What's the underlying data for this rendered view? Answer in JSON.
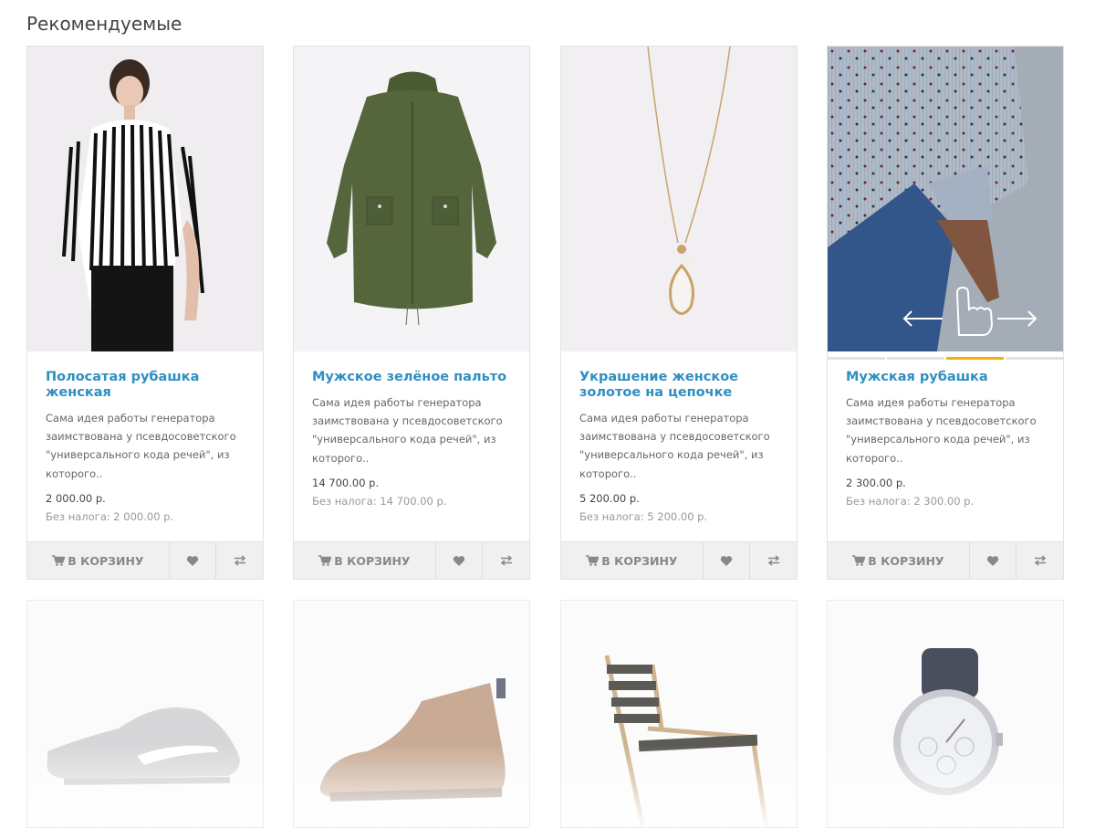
{
  "section": {
    "title": "Рекомендуемые"
  },
  "products": [
    {
      "name": "Полосатая рубашка женская",
      "description": "Сама идея работы генератора заимствована у псевдосоветского \"универсального кода речей\", из которого..",
      "price": "2 000.00 р.",
      "tax": "Без налога: 2 000.00 р.",
      "cart_label": "В КОРЗИНУ"
    },
    {
      "name": "Мужское зелёное пальто",
      "description": "Сама идея работы генератора заимствована у псевдосоветского \"универсального кода речей\", из которого..",
      "price": "14 700.00 р.",
      "tax": "Без налога: 14 700.00 р.",
      "cart_label": "В КОРЗИНУ"
    },
    {
      "name": "Украшение женское золотое на цепочке",
      "description": "Сама идея работы генератора заимствована у псевдосоветского \"универсального кода речей\", из которого..",
      "price": "5 200.00 р.",
      "tax": "Без налога: 5 200.00 р.",
      "cart_label": "В КОРЗИНУ"
    },
    {
      "name": "Мужская рубашка",
      "description": "Сама идея работы генератора заимствована у псевдосоветского \"универсального кода речей\", из которого..",
      "price": "2 300.00 р.",
      "tax": "Без налога: 2 300.00 р.",
      "cart_label": "В КОРЗИНУ"
    }
  ],
  "colors": {
    "link": "#2f8fc1",
    "slider_active": "#f0b400",
    "button_bar": "#f0f0f0"
  },
  "icons": [
    "cart-icon",
    "heart-icon",
    "compare-icon",
    "swipe-hand-icon"
  ]
}
